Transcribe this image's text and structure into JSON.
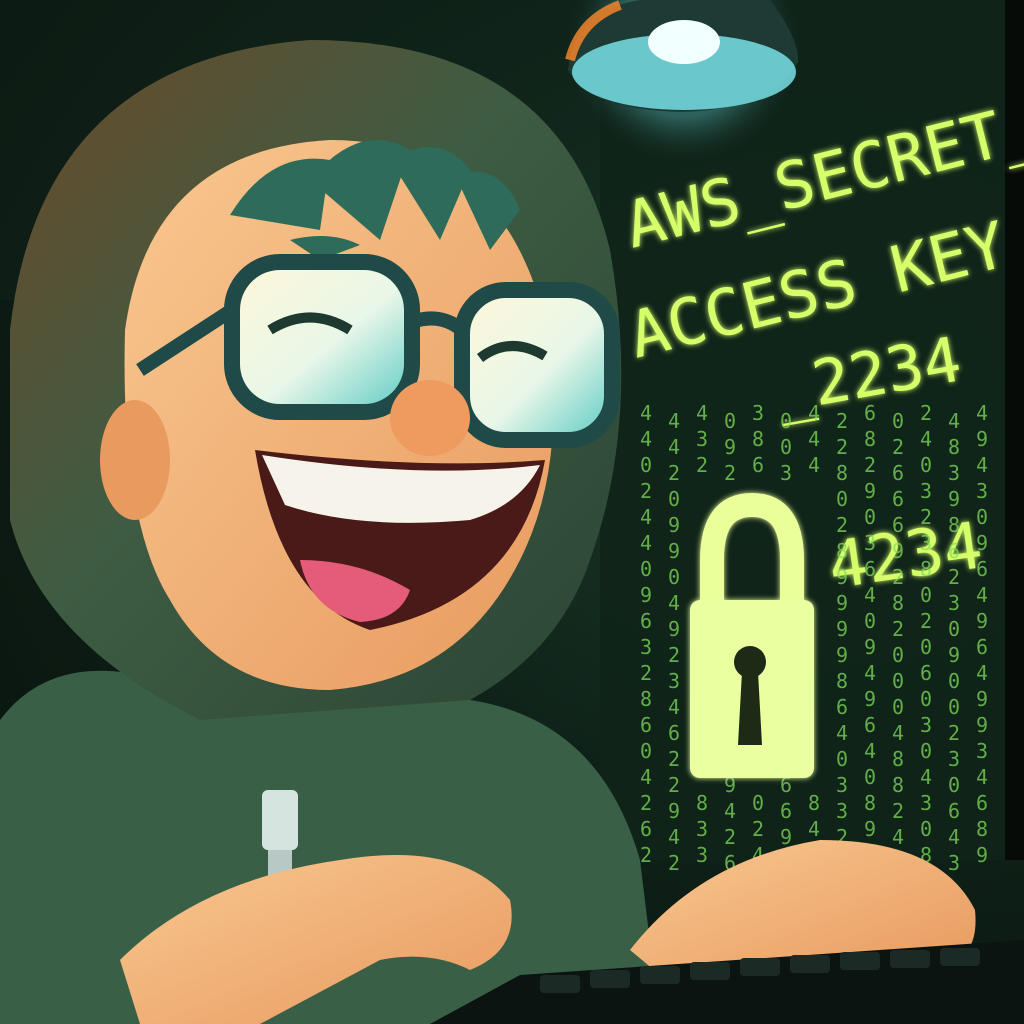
{
  "screen": {
    "heading_line1": "AWS_SECRET_",
    "heading_line2": "ACCESS KEY",
    "code_line1": "_2234",
    "code_line2": "4234"
  },
  "colors": {
    "screen_glow": "#c8ff5a",
    "hoodie": "#355e45",
    "skin": "#f2b27a",
    "lamp_light": "#9ff7ff"
  }
}
